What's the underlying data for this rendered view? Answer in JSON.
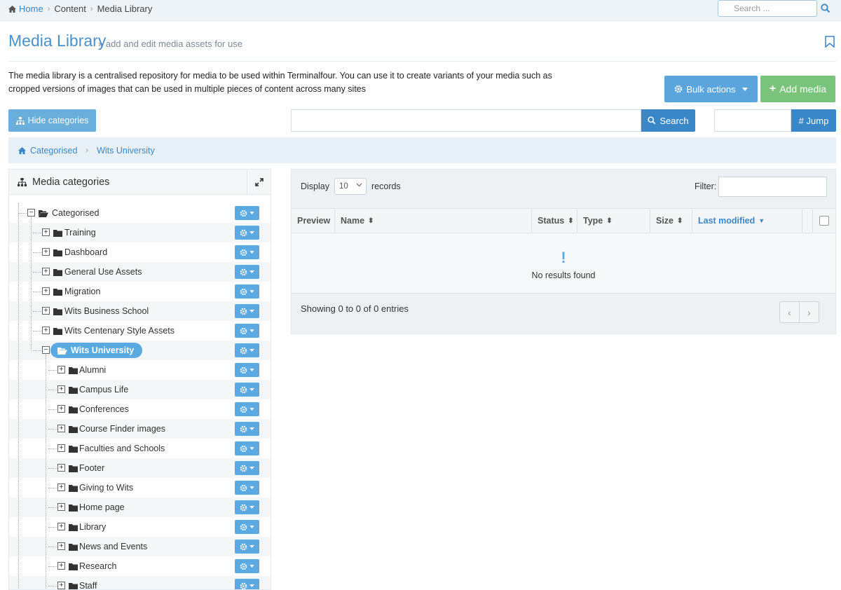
{
  "breadcrumb": {
    "home": "Home",
    "items": [
      "Content",
      "Media Library"
    ]
  },
  "top_search": {
    "placeholder": "Search ..."
  },
  "page": {
    "title": "Media Library",
    "subtitle": "» add and edit media assets for use",
    "description": "The media library is a centralised repository for media to be used within Terminalfour. You can use it to create variants of your media such as cropped versions of images that can be used in multiple pieces of content across many sites"
  },
  "buttons": {
    "bulk_actions": "Bulk actions",
    "add_media": "Add media",
    "hide_categories": "Hide categories",
    "search": "Search",
    "jump": "# Jump"
  },
  "category_path": [
    "Categorised",
    "Wits University"
  ],
  "categories_panel": {
    "title": "Media categories",
    "root": "Categorised",
    "level1": [
      "Training",
      "Dashboard",
      "General Use Assets",
      "Migration",
      "Wits Business School",
      "Wits Centenary Style Assets"
    ],
    "selected": "Wits University",
    "level2": [
      "Alumni",
      "Campus Life",
      "Conferences",
      "Course Finder images",
      "Faculties and Schools",
      "Footer",
      "Giving to Wits",
      "Home page",
      "Library",
      "News and Events",
      "Research",
      "Staff"
    ]
  },
  "media_table": {
    "display_label": "Display",
    "display_value": "10",
    "records_label": "records",
    "filter_label": "Filter:",
    "columns": [
      "Preview",
      "Name",
      "Status",
      "Type",
      "Size",
      "Last modified"
    ],
    "empty_icon": "!",
    "empty_text": "No results found",
    "showing": "Showing 0 to 0 of 0 entries",
    "pager_prev": "‹",
    "pager_next": "›"
  },
  "colors": {
    "primary": "#3a87c8",
    "light_blue": "#5ba4dc",
    "green": "#79c37a"
  }
}
